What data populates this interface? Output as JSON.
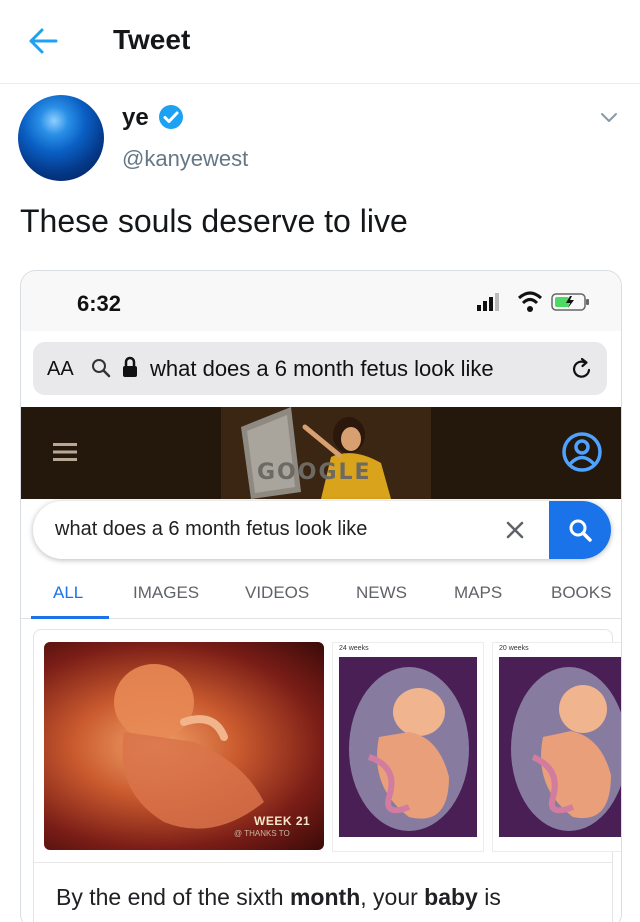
{
  "header": {
    "title": "Tweet",
    "back_icon": "back-arrow-icon"
  },
  "tweet": {
    "author_name": "ye",
    "handle": "@kanyewest",
    "text": "These souls deserve to live",
    "verified_icon": "verified-badge-icon",
    "menu_icon": "chevron-down-icon"
  },
  "embedded_screenshot": {
    "status_bar": {
      "time": "6:32"
    },
    "url_bar": {
      "aa_label": "AA",
      "url_text": "what does a 6 month fetus look like"
    },
    "google": {
      "doodle_text": "GOOGLE",
      "search_query": "what does a 6 month fetus look like",
      "tabs": [
        {
          "label": "ALL",
          "active": true
        },
        {
          "label": "IMAGES",
          "active": false
        },
        {
          "label": "VIDEOS",
          "active": false
        },
        {
          "label": "NEWS",
          "active": false
        },
        {
          "label": "MAPS",
          "active": false
        },
        {
          "label": "BOOKS",
          "active": false
        }
      ],
      "images": [
        {
          "caption": "WEEK 21",
          "subcaption": "@ THANKS TO"
        },
        {
          "caption": "24 weeks"
        },
        {
          "caption": "20 weeks"
        }
      ],
      "snippet": {
        "part1": "By the end of the sixth ",
        "bold1": "month",
        "part2": ", your ",
        "bold2": "baby",
        "part3": " is"
      }
    }
  },
  "colors": {
    "accent": "#1da1f2",
    "google_blue": "#1a73e8",
    "handle_gray": "#657786"
  }
}
